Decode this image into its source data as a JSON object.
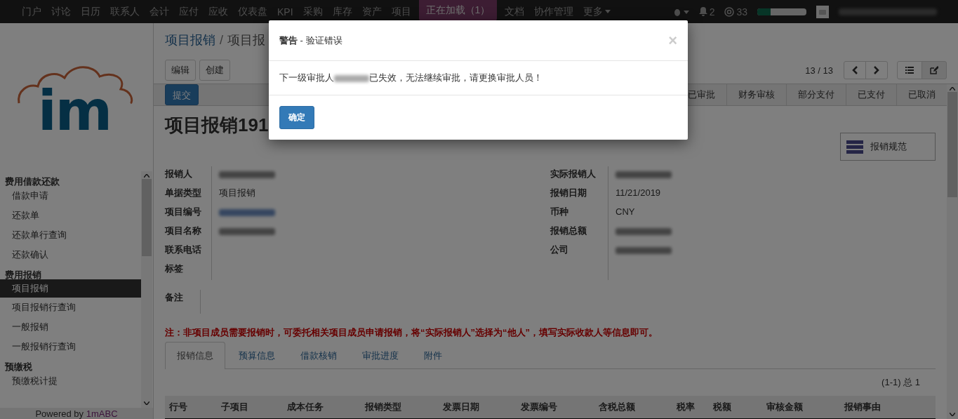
{
  "top_nav": {
    "items": [
      "门户",
      "讨论",
      "日历",
      "联系人",
      "会计",
      "应付",
      "应收",
      "仪表盘",
      "KPI",
      "采购",
      "库存",
      "资产",
      "项目"
    ],
    "items_after": [
      "文档",
      "协作管理",
      "更多"
    ],
    "loading": "正在加载（1）",
    "notifications": "2",
    "mentions": "33",
    "progress": {
      "level": 0.27
    }
  },
  "sidebar": {
    "logo_text": "im",
    "groups": [
      {
        "title": "费用借款还款",
        "items": [
          {
            "label": "借款申请",
            "selected": false
          },
          {
            "label": "还款单",
            "selected": false
          },
          {
            "label": "还款单行查询",
            "selected": false
          },
          {
            "label": "还款确认",
            "selected": false
          }
        ]
      },
      {
        "title": "费用报销",
        "items": [
          {
            "label": "项目报销",
            "selected": true
          },
          {
            "label": "项目报销行查询",
            "selected": false
          },
          {
            "label": "一般报销",
            "selected": false
          },
          {
            "label": "一般报销行查询",
            "selected": false
          }
        ]
      },
      {
        "title": "预缴税",
        "items": [
          {
            "label": "预缴税计提",
            "selected": false
          }
        ]
      }
    ],
    "footer_prefix": "Powered by",
    "footer_brand": "1mABC"
  },
  "breadcrumb": [
    "项目报销",
    "项目报"
  ],
  "breadcrumb_separator": "/",
  "buttons": [
    "编辑",
    "创建"
  ],
  "pager": "13 / 13",
  "submit_button": "提交",
  "stages": [
    "已审批",
    "财务审核",
    "部分支付",
    "已支付",
    "已取消"
  ],
  "record_title": "项目报销191",
  "guide_button": "报销规范",
  "fields_left": [
    {
      "label": "报销人",
      "kind": "blurred"
    },
    {
      "label": "单据类型",
      "kind": "text",
      "value": "项目报销"
    },
    {
      "label": "项目编号",
      "kind": "blurred_link"
    },
    {
      "label": "项目名称",
      "kind": "blurred"
    },
    {
      "label": "联系电话",
      "kind": "empty"
    },
    {
      "label": "标签",
      "kind": "empty"
    }
  ],
  "fields_right": [
    {
      "label": "实际报销人",
      "kind": "blurred"
    },
    {
      "label": "报销日期",
      "kind": "text",
      "value": "11/21/2019"
    },
    {
      "label": "币种",
      "kind": "text",
      "value": "CNY"
    },
    {
      "label": "报销总额",
      "kind": "blurred"
    },
    {
      "label": "公司",
      "kind": "blurred"
    }
  ],
  "remark_label": "备注",
  "note": "注：非项目成员需要报销时，可委托相关项目成员申请报销，将“实际报销人”选择为“他人”，填写实际收款人等信息即可。",
  "tabs": [
    {
      "label": "报销信息",
      "selected": true
    },
    {
      "label": "预算信息",
      "selected": false
    },
    {
      "label": "借款核销",
      "selected": false
    },
    {
      "label": "审批进度",
      "selected": false
    },
    {
      "label": "附件",
      "selected": false
    }
  ],
  "table": {
    "count": "(1-1) 总 1",
    "columns": [
      "行号",
      "子项目",
      "成本任务",
      "报销类型",
      "发票日期",
      "发票编号",
      "含税总额",
      "税率",
      "税额",
      "审核金额",
      "报销事由"
    ]
  },
  "dialog": {
    "title": "**警告** - 验证错误",
    "close": "×",
    "message_before": "下一级审批人",
    "message_after": "已失效，无法继续审批，请更换审批人员！",
    "ok": "确定"
  }
}
